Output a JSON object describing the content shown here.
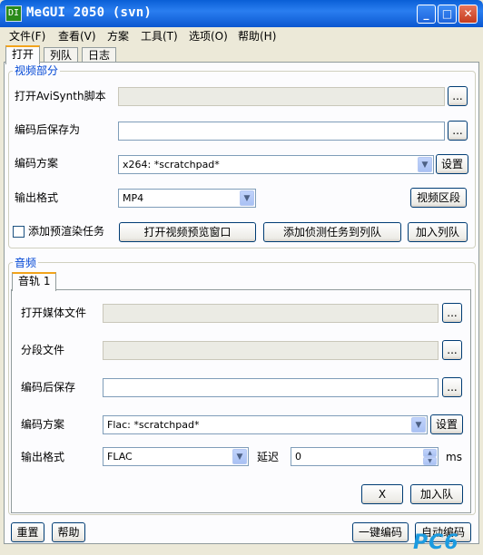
{
  "window": {
    "icon_text": "DI",
    "title": "MeGUI 2050 (svn)"
  },
  "titlebar": {
    "minimize": "_",
    "maximize": "□",
    "close": "✕"
  },
  "menu": [
    "文件(F)",
    "查看(V)",
    "方案",
    "工具(T)",
    "选项(O)",
    "帮助(H)"
  ],
  "tabs": [
    "打开",
    "列队",
    "日志"
  ],
  "video": {
    "group_title": "视频部分",
    "open_avisynth_label": "打开AviSynth脚本",
    "open_avisynth_value": "",
    "save_as_label": "编码后保存为",
    "save_as_value": "",
    "profile_label": "编码方案",
    "profile_value": "x264: *scratchpad*",
    "config_button": "设置",
    "format_label": "输出格式",
    "format_value": "MP4",
    "zones_button": "视频区段",
    "prerender_label": "添加预渲染任务",
    "prerender_checked": false,
    "preview_button": "打开视频预览窗口",
    "analysis_button": "添加侦测任务到列队",
    "enqueue_button": "加入列队",
    "browse": "..."
  },
  "audio": {
    "group_title": "音频",
    "track_tab": "音轨 1",
    "open_media_label": "打开媒体文件",
    "open_media_value": "",
    "cuts_label": "分段文件",
    "cuts_value": "",
    "save_label": "编码后保存",
    "save_value": "",
    "profile_label": "编码方案",
    "profile_value": "Flac: *scratchpad*",
    "config_button": "设置",
    "format_label": "输出格式",
    "format_value": "FLAC",
    "delay_label": "延迟",
    "delay_value": "0",
    "delay_unit": "ms",
    "remove_button": "X",
    "enqueue_button": "加入队",
    "browse": "..."
  },
  "footer": {
    "reset_button": "重置",
    "help_button": "帮助",
    "oneclick_button": "一键编码",
    "autoencode_button": "自动编码"
  },
  "watermark": "PC6",
  "colors": {
    "titlebar": "#0b57d0",
    "group_title": "#0046d5",
    "active_tab_accent": "#f2a31b"
  }
}
